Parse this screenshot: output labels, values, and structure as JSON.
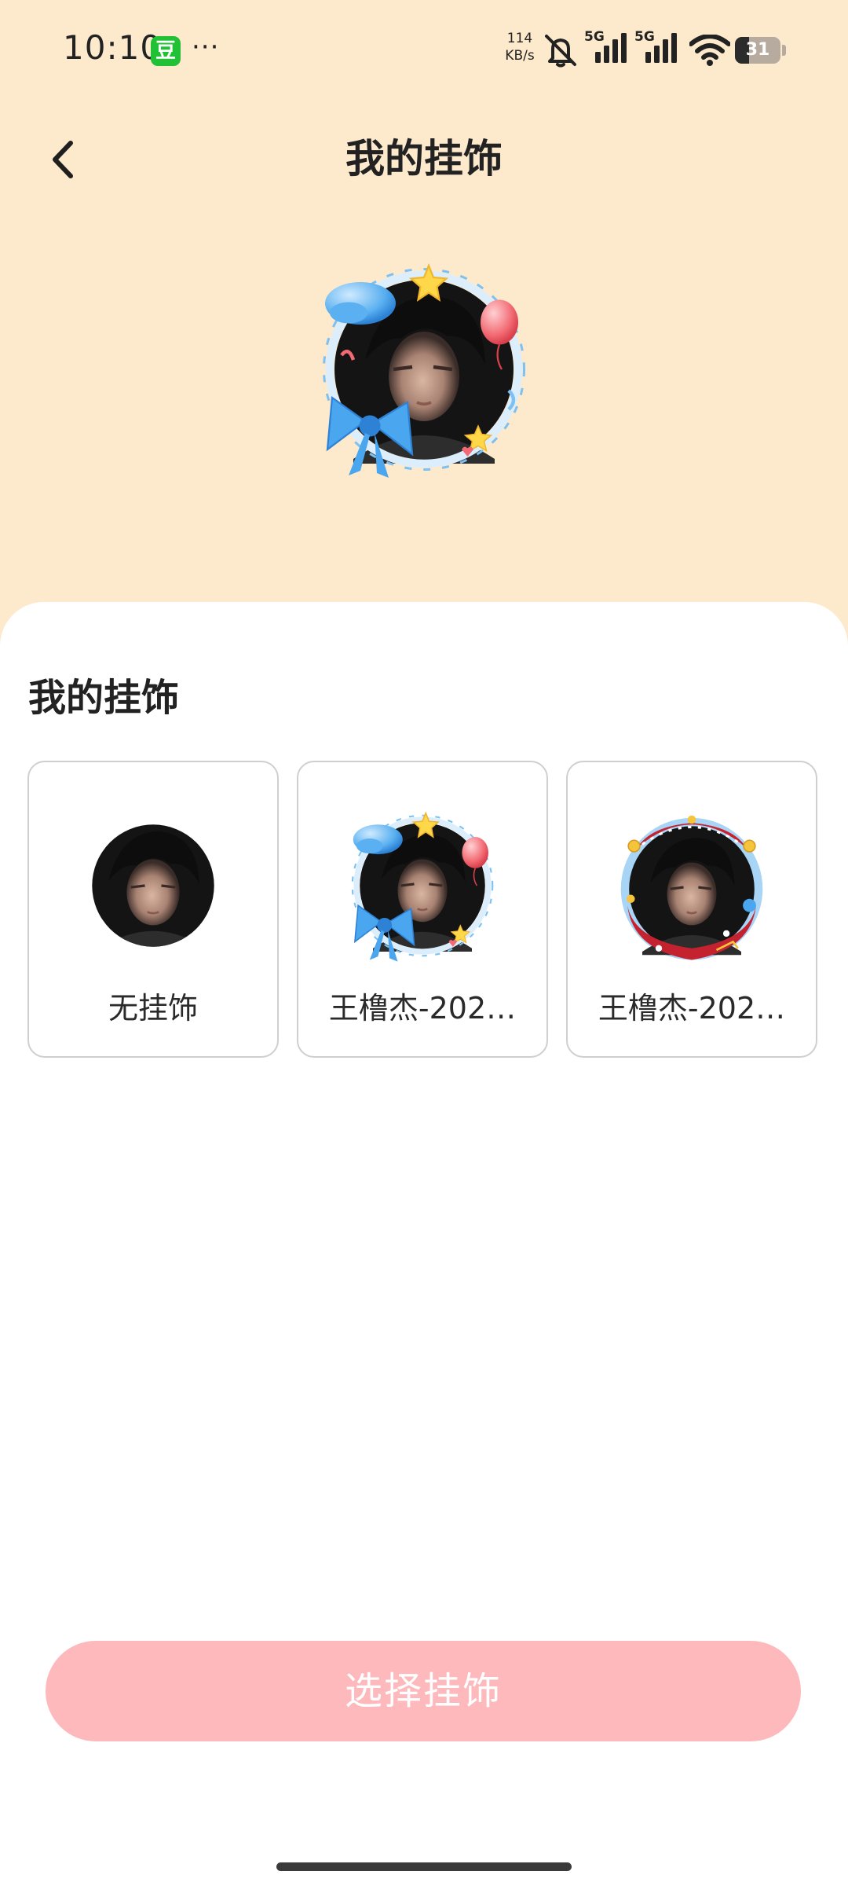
{
  "status_bar": {
    "time": "10:10",
    "app_badge": "豆",
    "more_dots": "···",
    "net_speed_value": "114",
    "net_speed_unit": "KB/s",
    "signal_1_label": "5G",
    "signal_2_label": "5G",
    "battery_level": "31",
    "icons": [
      "mute-icon",
      "signal-5g-icon",
      "signal-5g-icon",
      "wifi-icon",
      "battery-icon"
    ]
  },
  "header": {
    "title": "我的挂饰",
    "back_icon": "chevron-left-icon"
  },
  "section": {
    "title": "我的挂饰"
  },
  "decorations": [
    {
      "label": "无挂饰",
      "frame": "none"
    },
    {
      "label": "王橹杰-202…",
      "frame": "blue-balloon-bow"
    },
    {
      "label": "王橹杰-202…",
      "frame": "red-festive"
    }
  ],
  "select_button": {
    "label": "选择挂饰"
  },
  "colors": {
    "header_background": "#fde9cb",
    "sheet_background": "#ffffff",
    "button_background": "#fdb9bb",
    "button_text": "#ffffff",
    "card_border": "#cfcfcf"
  }
}
